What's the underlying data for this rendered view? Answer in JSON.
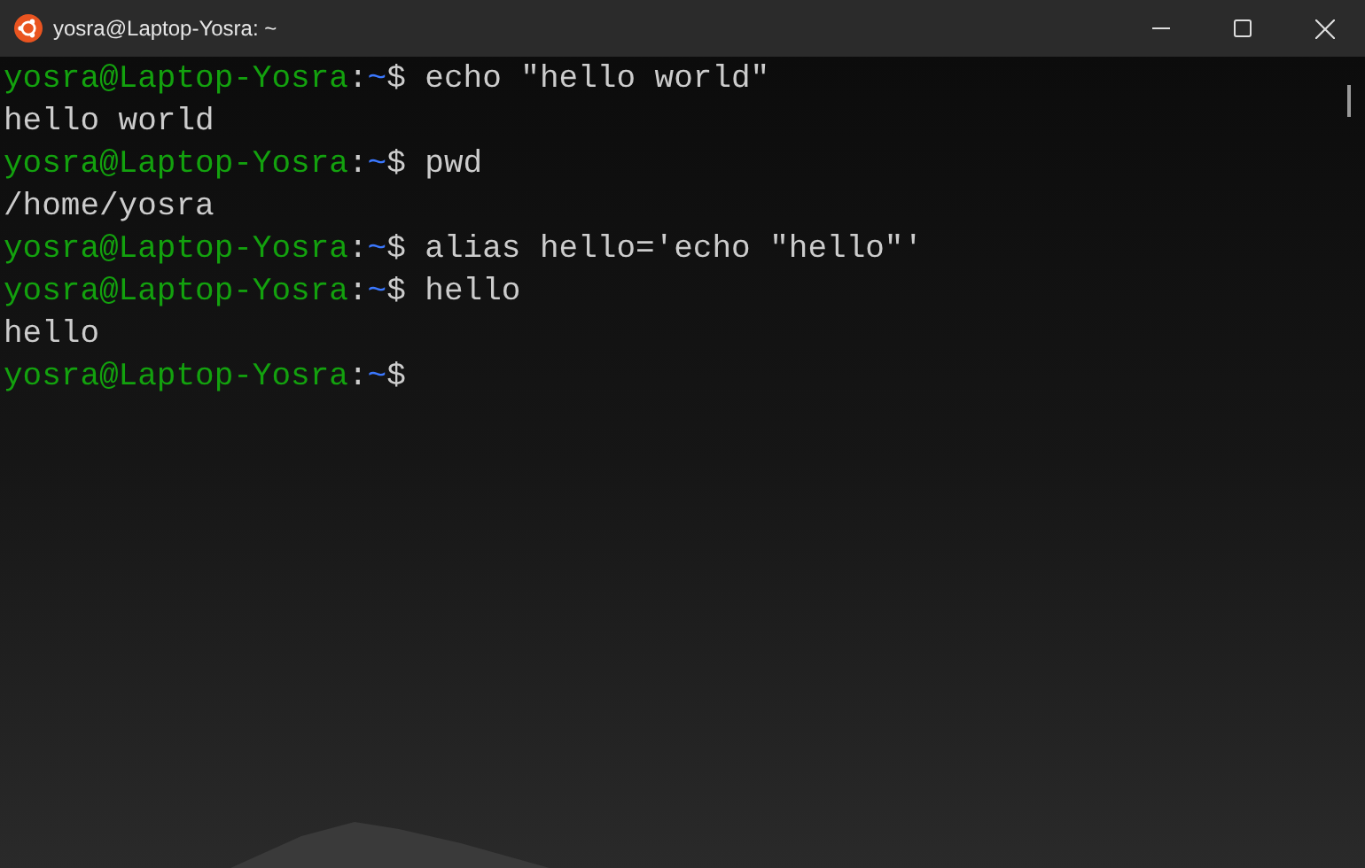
{
  "window": {
    "title": "yosra@Laptop-Yosra: ~"
  },
  "lines": [
    {
      "kind": "prompt",
      "user": "yosra@Laptop-Yosra",
      "separator": ":",
      "path": "~",
      "symbol": "$",
      "command": "echo \"hello world\""
    },
    {
      "kind": "output",
      "text": "hello world"
    },
    {
      "kind": "prompt",
      "user": "yosra@Laptop-Yosra",
      "separator": ":",
      "path": "~",
      "symbol": "$",
      "command": "pwd"
    },
    {
      "kind": "output",
      "text": "/home/yosra"
    },
    {
      "kind": "prompt",
      "user": "yosra@Laptop-Yosra",
      "separator": ":",
      "path": "~",
      "symbol": "$",
      "command": "alias hello='echo \"hello\"'"
    },
    {
      "kind": "prompt",
      "user": "yosra@Laptop-Yosra",
      "separator": ":",
      "path": "~",
      "symbol": "$",
      "command": "hello"
    },
    {
      "kind": "output",
      "text": "hello"
    },
    {
      "kind": "prompt",
      "user": "yosra@Laptop-Yosra",
      "separator": ":",
      "path": "~",
      "symbol": "$"
    }
  ]
}
